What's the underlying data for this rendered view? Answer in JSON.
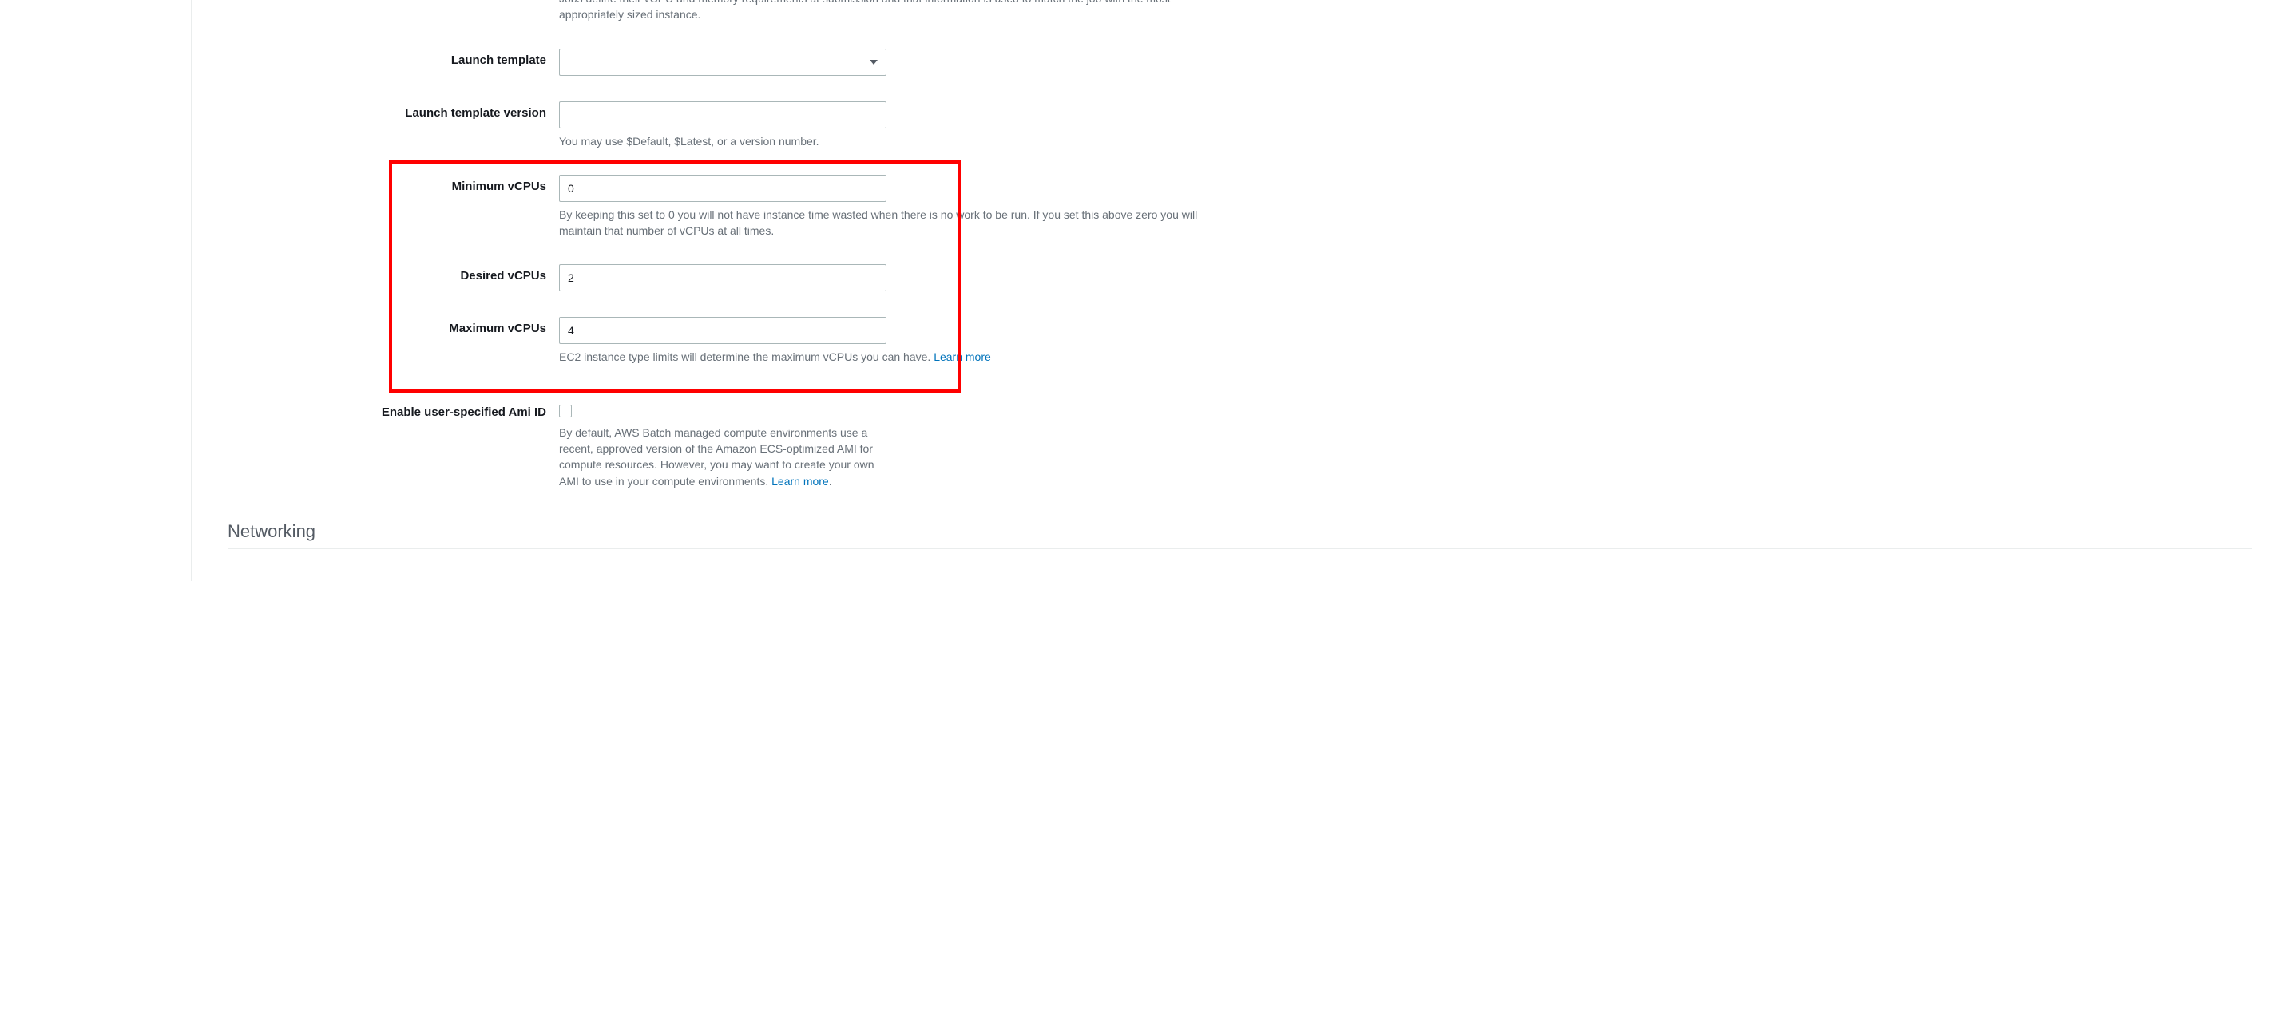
{
  "intro_help": "Jobs define their vCPU and memory requirements at submission and that information is used to match the job with the most appropriately sized instance.",
  "fields": {
    "launch_template": {
      "label": "Launch template",
      "value": ""
    },
    "launch_template_version": {
      "label": "Launch template version",
      "value": "",
      "help": "You may use $Default, $Latest, or a version number."
    },
    "min_vcpus": {
      "label": "Minimum vCPUs",
      "value": "0",
      "help": "By keeping this set to 0 you will not have instance time wasted when there is no work to be run. If you set this above zero you will maintain that number of vCPUs at all times."
    },
    "desired_vcpus": {
      "label": "Desired vCPUs",
      "value": "2"
    },
    "max_vcpus": {
      "label": "Maximum vCPUs",
      "value": "4",
      "help": "EC2 instance type limits will determine the maximum vCPUs you can have. ",
      "learn_more": "Learn more"
    },
    "enable_ami": {
      "label": "Enable user-specified Ami ID",
      "checked": false,
      "help": "By default, AWS Batch managed compute environments use a recent, approved version of the Amazon ECS-optimized AMI for compute resources. However, you may want to create your own AMI to use in your compute environments. ",
      "learn_more": "Learn more"
    }
  },
  "section_heading": "Networking",
  "highlight_color": "#ff0000"
}
